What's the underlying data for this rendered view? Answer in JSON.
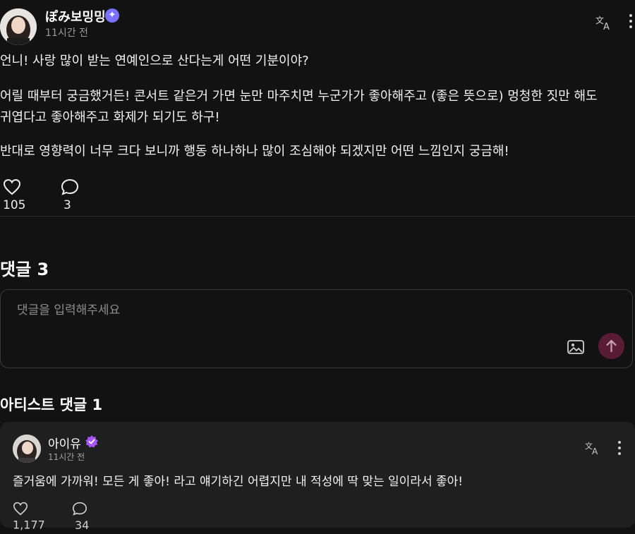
{
  "post": {
    "author": "ぽみ보밍밍",
    "verified_badge": "sparkle-badge",
    "time": "11시간 전",
    "paragraphs": [
      "언니! 사랑 많이 받는 연예인으로 산다는게 어떤 기분이야?",
      "어릴 때부터 궁금했거든! 콘서트 같은거 가면 눈만 마주치면 누군가가 좋아해주고 (좋은 뜻으로) 멍청한 짓만 해도 귀엽다고 좋아해주고 화제가 되기도 하구!",
      "반대로 영향력이 너무 크다 보니까 행동 하나하나 많이 조심해야 되겠지만 어떤 느낌인지 궁금해!"
    ],
    "likes": "105",
    "comments": "3",
    "icons": {
      "translate": "translate-icon",
      "more": "more-vertical-icon",
      "like": "heart-icon",
      "comment": "comment-bubble-icon"
    }
  },
  "comments_section": {
    "title": "댓글 3",
    "input_placeholder": "댓글을 입력해주세요",
    "icons": {
      "image": "image-icon",
      "send": "arrow-up-icon"
    },
    "send_color": "#5a1c34"
  },
  "artist_section": {
    "title": "아티스트 댓글 1",
    "comment": {
      "author": "아이유",
      "badge_color": "#a855f7",
      "time": "11시간 전",
      "text": "즐거움에 가까워! 모든 게 좋아! 라고 얘기하긴 어렵지만 내 적성에 딱 맞는 일이라서 좋아!",
      "likes": "1,177",
      "comments": "34"
    }
  },
  "colors": {
    "background": "#121212",
    "card": "#1f1f1f",
    "verified_blue": "#7a72ff"
  }
}
